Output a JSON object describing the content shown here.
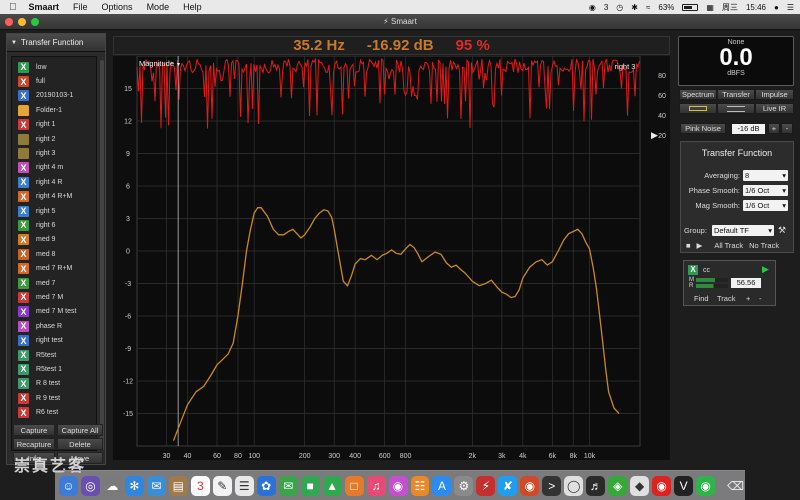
{
  "menubar": {
    "app": "Smaart",
    "items": [
      "File",
      "Options",
      "Mode",
      "Help"
    ],
    "status": {
      "chat_count": "3",
      "battery": "63%",
      "battery_fraction": 0.63,
      "day": "周三",
      "time": "15:46"
    }
  },
  "window": {
    "title": "Smaart"
  },
  "left_panel": {
    "header": "Transfer Function",
    "traces": [
      {
        "label": "low",
        "type": "x",
        "color": "#2e9a52"
      },
      {
        "label": "full",
        "type": "x",
        "color": "#c9462f"
      },
      {
        "label": "20190103-1",
        "type": "x",
        "color": "#3a6fc6"
      },
      {
        "label": "Folder-1",
        "type": "folder",
        "color": "#e3a43a"
      },
      {
        "label": "right 1",
        "type": "x",
        "color": "#c93a3a"
      },
      {
        "label": "right 2",
        "type": "plain",
        "color": "#8f7a3a"
      },
      {
        "label": "right 3",
        "type": "plain",
        "color": "#8f7a3a"
      },
      {
        "label": "right 4 m",
        "type": "x",
        "color": "#c04fb6"
      },
      {
        "label": "right 4 R",
        "type": "x",
        "color": "#3b7ec9"
      },
      {
        "label": "right 4 R+M",
        "type": "x",
        "color": "#d06a2a"
      },
      {
        "label": "right 5",
        "type": "x",
        "color": "#3a7fd0"
      },
      {
        "label": "right 6",
        "type": "x",
        "color": "#3e9a3e"
      },
      {
        "label": "med 9",
        "type": "x",
        "color": "#d07a2a"
      },
      {
        "label": "med 8",
        "type": "x",
        "color": "#c76226"
      },
      {
        "label": "med 7 R+M",
        "type": "x",
        "color": "#d06a2a"
      },
      {
        "label": "med 7",
        "type": "x",
        "color": "#3e9a3e"
      },
      {
        "label": "med 7 M",
        "type": "x",
        "color": "#c93a3a"
      },
      {
        "label": "med 7 M test",
        "type": "x",
        "color": "#8a3ac9"
      },
      {
        "label": "phase R",
        "type": "x",
        "color": "#b84fc0"
      },
      {
        "label": "right test",
        "type": "x",
        "color": "#3a6fc6"
      },
      {
        "label": "R5test",
        "type": "x",
        "color": "#3e9a6a"
      },
      {
        "label": "R5test 1",
        "type": "x",
        "color": "#3e9a6a"
      },
      {
        "label": "R 8 test",
        "type": "x",
        "color": "#3e9a6a"
      },
      {
        "label": "R 9 test",
        "type": "x",
        "color": "#c93a3a"
      },
      {
        "label": "R6 test",
        "type": "x",
        "color": "#c93a3a"
      }
    ],
    "buttons": {
      "capture": "Capture",
      "capture_all": "Capture All",
      "recapture": "Recapture",
      "delete": "Delete",
      "info": "Info",
      "move": "Move"
    }
  },
  "readout": {
    "freq": "35.2 Hz",
    "level": "-16.92 dB",
    "coherence": "95 %"
  },
  "plot": {
    "magnitude_label": "Magnitude",
    "trace_name": "right 3",
    "chart_data": {
      "type": "line",
      "x_scale": "log",
      "xlim": [
        20,
        20000
      ],
      "x_ticks": [
        30,
        40,
        60,
        80,
        100,
        200,
        300,
        400,
        600,
        800,
        2000,
        3000,
        4000,
        6000,
        8000,
        10000
      ],
      "x_tick_labels": [
        "30",
        "40",
        "60",
        "80",
        "100",
        "200",
        "300",
        "400",
        "600",
        "800",
        "2k",
        "3k",
        "4k",
        "6k",
        "8k",
        "10k"
      ],
      "ylim": [
        -18,
        18
      ],
      "y_ticks": [
        15,
        12,
        9,
        6,
        3,
        0,
        -3,
        -6,
        -9,
        -12,
        -15
      ],
      "coherence_ticks": [
        80,
        60,
        40,
        20
      ],
      "cursor_hz": 35.2,
      "series": [
        {
          "color": "#c88a1e",
          "x": [
            33,
            36,
            40,
            45,
            50,
            55,
            60,
            65,
            70,
            75,
            80,
            85,
            90,
            95,
            100,
            105,
            110,
            120,
            130,
            140,
            150,
            160,
            170,
            180,
            190,
            200,
            215,
            230,
            245,
            260,
            275,
            290,
            300,
            320,
            340,
            360,
            380,
            400,
            430,
            460,
            500,
            540,
            580,
            620,
            660,
            700,
            750,
            800,
            850,
            900,
            950,
            1000,
            1100,
            1200,
            1300,
            1400,
            1500,
            1600,
            1700,
            1800,
            1900,
            2000,
            2200,
            2400,
            2600,
            2800,
            3000,
            3200,
            3400,
            3600,
            3800,
            4000,
            4400,
            4800,
            5200,
            5600,
            6000,
            6500,
            7000,
            7500,
            8000,
            8500,
            9000,
            9500,
            10000,
            10500,
            11000,
            11500,
            12000,
            12500,
            13000,
            14000,
            15000
          ],
          "y": [
            -17.5,
            -16,
            -14.2,
            -13,
            -12.5,
            -11.5,
            -10.5,
            -10,
            -9.5,
            -8.5,
            -6,
            -3,
            0,
            2,
            3.5,
            4,
            4,
            3.2,
            2,
            1.5,
            1.5,
            1.8,
            2,
            1.6,
            1.2,
            1.5,
            2.2,
            3.0,
            3.5,
            3.8,
            3.7,
            3.1,
            2.0,
            -0.5,
            -2.8,
            -3.2,
            -2.3,
            -1.2,
            -0.7,
            -0.8,
            -0.4,
            -0.8,
            -0.4,
            -0.2,
            0.1,
            -0.2,
            -0.3,
            0.2,
            0.6,
            0.3,
            -0.3,
            -1.0,
            -0.5,
            -0.1,
            -0.3,
            -1.1,
            -1.5,
            -1.3,
            -1.7,
            -2.0,
            -2.4,
            -2.8,
            -3.2,
            -3.0,
            -2.7,
            -3.3,
            -3.8,
            -4.0,
            -4.3,
            -4.2,
            -3.6,
            -2.5,
            -1.5,
            -1.0,
            -0.8,
            -1.3,
            -1.0,
            0.0,
            1.0,
            1.6,
            1.8,
            2.0,
            1.6,
            0.8,
            0.2,
            -1.5,
            -3.5,
            -6.0,
            -8.5,
            -11.0,
            -13.0,
            -14.5,
            -15.0
          ]
        }
      ]
    }
  },
  "right_panel": {
    "meter": {
      "source": "None",
      "value": "0.0",
      "unit": "dBFS"
    },
    "tabs": [
      "Spectrum",
      "Transfer",
      "Impulse"
    ],
    "live_ir": "Live IR",
    "generator": {
      "label": "Pink Noise",
      "level": "-16 dB",
      "plus": "+",
      "minus": "-"
    },
    "settings": {
      "title": "Transfer Function",
      "averaging_label": "Averaging:",
      "averaging_value": "8",
      "phase_smooth_label": "Phase Smooth:",
      "phase_smooth_value": "1/6 Oct",
      "mag_smooth_label": "Mag Smooth:",
      "mag_smooth_value": "1/6 Oct"
    },
    "group": {
      "label": "Group:",
      "value": "Default TF",
      "all_track": "All Track",
      "no_track": "No Track"
    },
    "trace_card": {
      "name": "cc",
      "m_label": "M",
      "r_label": "R",
      "delay": "56.56",
      "find": "Find",
      "track": "Track",
      "plus": "+",
      "minus": "-"
    }
  },
  "dock": {
    "calendar_day": "3"
  },
  "watermark": "崇真艺客",
  "colors": {
    "accent": "#c88a1e",
    "coherence": "#e21a1a",
    "readout": "#c87a28",
    "readout_red": "#e02a2a"
  }
}
